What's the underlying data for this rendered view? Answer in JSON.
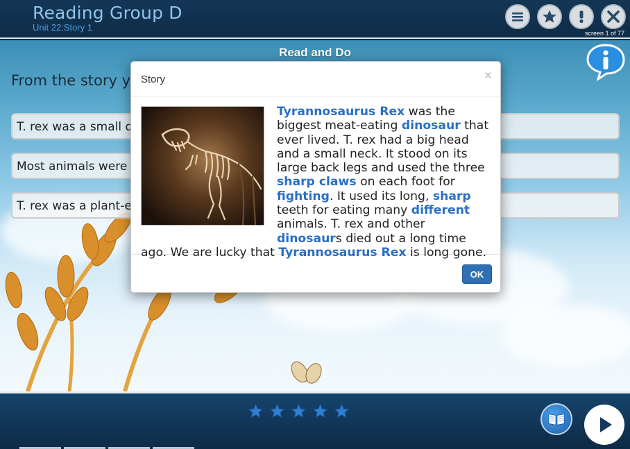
{
  "header": {
    "title": "Reading Group D",
    "subtitle": "Unit 22:Story 1",
    "screen_count": "screen 1 of 77",
    "icons": [
      "menu-icon",
      "star-icon",
      "alert-icon",
      "close-icon"
    ]
  },
  "activity": {
    "title": "Read and Do",
    "question": "From the story yo",
    "options": [
      "T. rex was a small di",
      "Most animals were",
      "T. rex was a plant-ea"
    ]
  },
  "modal": {
    "title": "Story",
    "close_label": "×",
    "ok_label": "OK",
    "image_icon": "t-rex-skeleton-photo",
    "story": [
      {
        "t": "Tyrannosaurus Rex",
        "k": true
      },
      {
        "t": " was the biggest meat-eating ",
        "k": false
      },
      {
        "t": "dinosaur",
        "k": true
      },
      {
        "t": " that ever lived. T. rex had a big head and a small neck. It stood on its large back legs and used the three ",
        "k": false
      },
      {
        "t": "sharp claws",
        "k": true
      },
      {
        "t": " on each foot for ",
        "k": false
      },
      {
        "t": "fighting",
        "k": true
      },
      {
        "t": ". It used its long, ",
        "k": false
      },
      {
        "t": "sharp",
        "k": true
      },
      {
        "t": " teeth for eating many ",
        "k": false
      },
      {
        "t": "different",
        "k": true
      },
      {
        "t": " animals. T. rex and other ",
        "k": false
      },
      {
        "t": "dinosaur",
        "k": true
      },
      {
        "t": "s died out a long time ago. We are lucky that ",
        "k": false
      },
      {
        "t": "Tyrannosaurus Rex",
        "k": true
      },
      {
        "t": " is long gone.",
        "k": false
      }
    ]
  },
  "footer": {
    "stars": 5,
    "icons": [
      "book-icon",
      "play-icon"
    ]
  },
  "colors": {
    "header_bg": "#0f2c47",
    "title_color": "#8fc3ea",
    "keyword": "#2a6fc4",
    "ok_button": "#2f6fb3"
  }
}
